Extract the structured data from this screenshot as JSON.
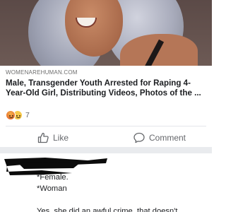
{
  "post": {
    "link": {
      "source": "WOMENAREHUMAN.COM",
      "headline": "Male, Transgender Youth Arrested for Raping 4-Year-Old Girl, Distributing Videos, Photos of the ..."
    },
    "reactions": {
      "types": [
        "angry",
        "sad"
      ],
      "count": "7"
    },
    "actions": {
      "like_label": "Like",
      "comment_label": "Comment"
    }
  },
  "comment": {
    "lines": [
      "*Female.",
      "*Woman",
      "Yes, she did an awful crime, that doesn't"
    ]
  }
}
